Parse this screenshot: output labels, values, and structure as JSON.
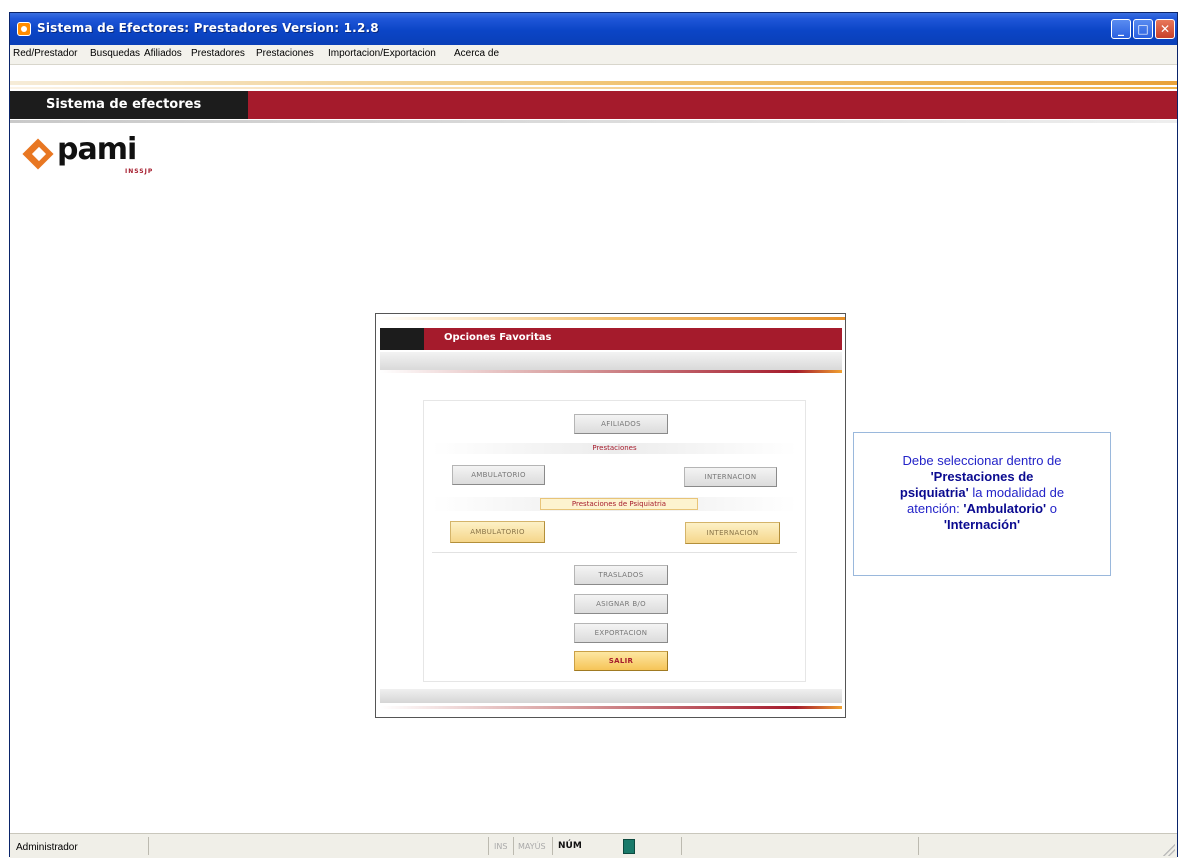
{
  "window": {
    "title": "Sistema de Efectores: Prestadores Version: 1.2.8",
    "controls": {
      "minimize": "_",
      "maximize": "□",
      "close": "✕"
    }
  },
  "menu": [
    "Red/Prestador",
    "Busquedas",
    "Afiliados",
    "Prestadores",
    "Prestaciones",
    "Importacion/Exportacion",
    "Acerca de"
  ],
  "header": {
    "title": "Sistema de efectores"
  },
  "logo": {
    "text": "pami",
    "subtext": "INSSJP"
  },
  "dialog": {
    "title": "Opciones Favoritas",
    "buttons": {
      "afiliados": "AFILIADOS",
      "prestaciones_ambulatorio": "AMBULATORIO",
      "prestaciones_internacion": "INTERNACION",
      "psiquiatria_ambulatorio": "AMBULATORIO",
      "psiquiatria_internacion": "INTERNACION",
      "traslados": "TRASLADOS",
      "asignar_bo": "ASIGNAR B/O",
      "exportacion": "EXPORTACION",
      "salir": "SALIR"
    },
    "sections": {
      "prestaciones": "Prestaciones",
      "psiquiatria": "Prestaciones de Psiquiatria"
    }
  },
  "callout": {
    "line1": "Debe seleccionar dentro de",
    "bold1": "'Prestaciones de",
    "bold2": "psiquiatria'",
    "line3": " la modalidad de",
    "line4": "atención: ",
    "bold3": "'Ambulatorio'",
    "line4b": " o",
    "bold4": "'Internación'"
  },
  "status": {
    "user": "Administrador",
    "ins": "INS",
    "mayus": "MAYÚS",
    "num": "NÚM"
  }
}
